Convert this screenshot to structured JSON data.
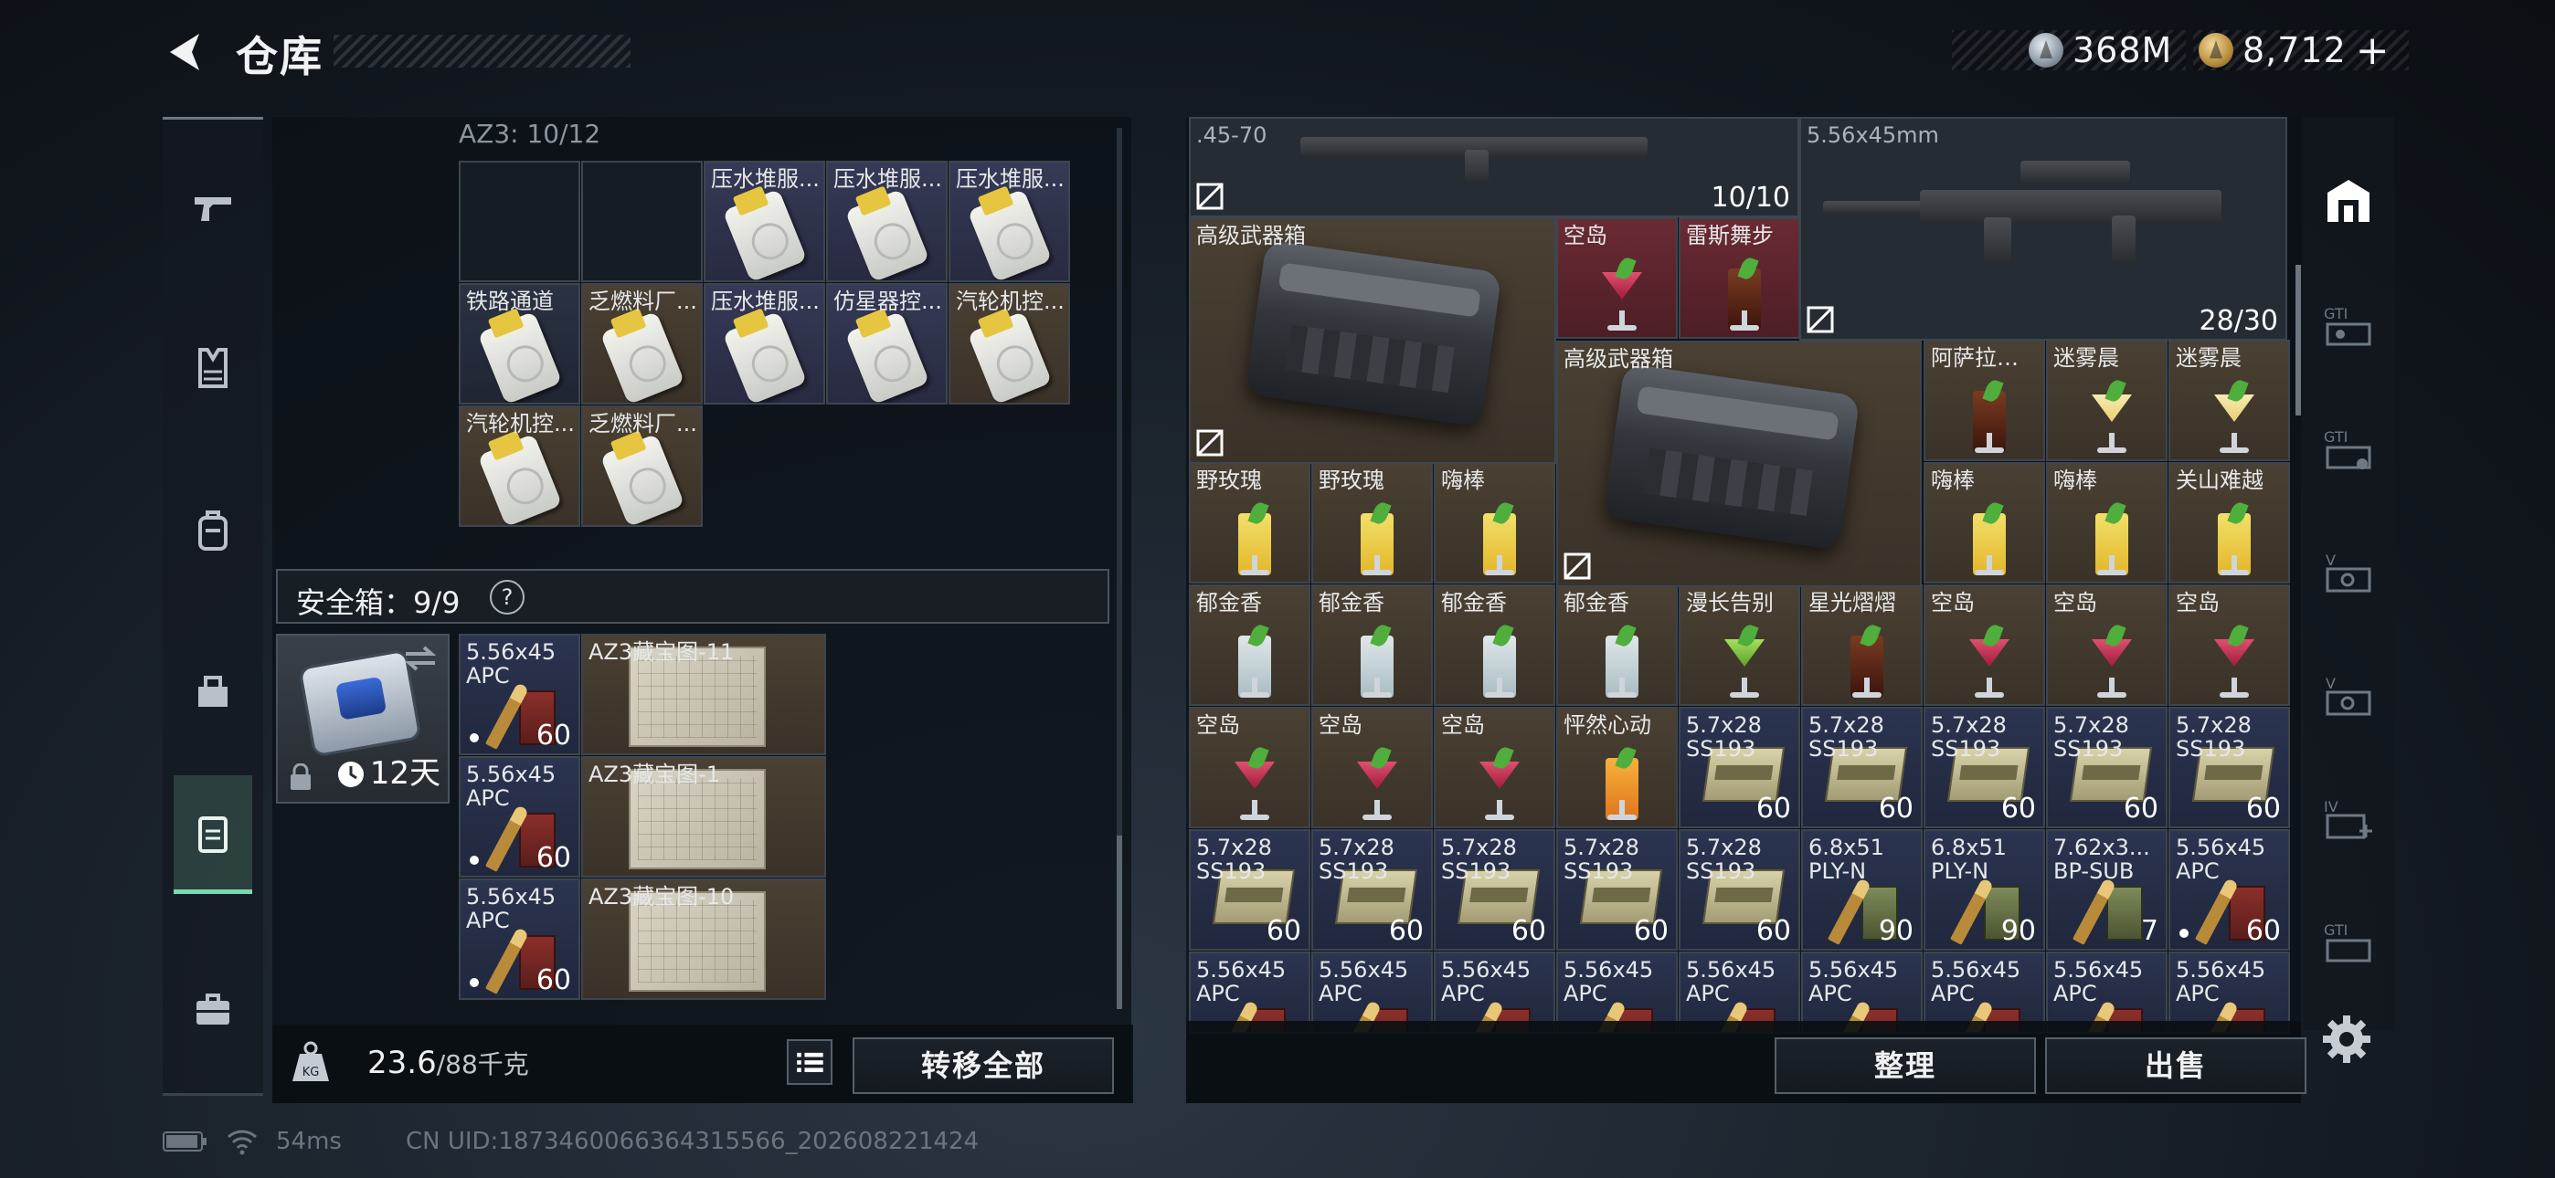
{
  "header": {
    "title": "仓库",
    "silver": "368M",
    "gold": "8,712",
    "plus": "+"
  },
  "left": {
    "grid_label": "AZ3: 10/12",
    "keys": [
      {
        "name": "",
        "bg": "empty"
      },
      {
        "name": "",
        "bg": "empty"
      },
      {
        "name": "压水堆服...",
        "bg": "purple"
      },
      {
        "name": "压水堆服...",
        "bg": "purple"
      },
      {
        "name": "压水堆服...",
        "bg": "purple"
      },
      {
        "name": "铁路通道",
        "bg": "blue"
      },
      {
        "name": "乏燃料厂...",
        "bg": "brown"
      },
      {
        "name": "压水堆服...",
        "bg": "purple"
      },
      {
        "name": "仿星器控...",
        "bg": "purple"
      },
      {
        "name": "汽轮机控...",
        "bg": "brown"
      },
      {
        "name": "汽轮机控...",
        "bg": "brown"
      },
      {
        "name": "乏燃料厂...",
        "bg": "brown"
      }
    ],
    "safe": {
      "label": "安全箱：9/9",
      "help": "?",
      "days": "12天"
    },
    "safe_items": [
      {
        "ammo_l1": "5.56x45",
        "ammo_l2": "APC",
        "ammo_count": "60",
        "map": "AZ3藏宝图-11"
      },
      {
        "ammo_l1": "5.56x45",
        "ammo_l2": "APC",
        "ammo_count": "60",
        "map": "AZ3藏宝图-1"
      },
      {
        "ammo_l1": "5.56x45",
        "ammo_l2": "APC",
        "ammo_count": "60",
        "map": "AZ3藏宝图-10"
      }
    ],
    "weight": "23.6",
    "weight_max": "/88千克",
    "transfer_label": "转移全部"
  },
  "right": {
    "gun1": {
      "caliber": ".45-70",
      "count": "10/10"
    },
    "gun2": {
      "caliber": "5.56x45mm",
      "count": "28/30"
    },
    "weapon_box_1": "高级武器箱",
    "weapon_box_2": "高级武器箱",
    "cells": [
      {
        "r": 1,
        "c": 3,
        "name": "空岛",
        "bg": "red",
        "art": "drink",
        "kind": "d-martini d-red"
      },
      {
        "r": 1,
        "c": 4,
        "name": "雷斯舞步",
        "bg": "red",
        "art": "drink",
        "kind": "d-tall d-cola"
      },
      {
        "r": 2,
        "c": 6,
        "name": "阿萨拉风情",
        "bg": "brown",
        "art": "drink",
        "kind": "d-tall d-cola"
      },
      {
        "r": 2,
        "c": 7,
        "name": "迷雾晨",
        "bg": "brown",
        "art": "drink",
        "kind": "d-martini d-pale"
      },
      {
        "r": 2,
        "c": 8,
        "name": "迷雾晨",
        "bg": "brown",
        "art": "drink",
        "kind": "d-martini d-pale"
      },
      {
        "r": 3,
        "c": 0,
        "name": "野玫瑰",
        "bg": "brown",
        "art": "drink",
        "kind": "d-tall"
      },
      {
        "r": 3,
        "c": 1,
        "name": "野玫瑰",
        "bg": "brown",
        "art": "drink",
        "kind": "d-tall"
      },
      {
        "r": 3,
        "c": 2,
        "name": "嗨棒",
        "bg": "brown",
        "art": "drink",
        "kind": "d-tall"
      },
      {
        "r": 3,
        "c": 6,
        "name": "嗨棒",
        "bg": "brown",
        "art": "drink",
        "kind": "d-tall"
      },
      {
        "r": 3,
        "c": 7,
        "name": "嗨棒",
        "bg": "brown",
        "art": "drink",
        "kind": "d-tall"
      },
      {
        "r": 3,
        "c": 8,
        "name": "关山难越",
        "bg": "brown",
        "art": "drink",
        "kind": "d-tall"
      },
      {
        "r": 4,
        "c": 0,
        "name": "郁金香",
        "bg": "brown",
        "art": "drink",
        "kind": "d-tall d-clear"
      },
      {
        "r": 4,
        "c": 1,
        "name": "郁金香",
        "bg": "brown",
        "art": "drink",
        "kind": "d-tall d-clear"
      },
      {
        "r": 4,
        "c": 2,
        "name": "郁金香",
        "bg": "brown",
        "art": "drink",
        "kind": "d-tall d-clear"
      },
      {
        "r": 4,
        "c": 3,
        "name": "郁金香",
        "bg": "brown",
        "art": "drink",
        "kind": "d-tall d-clear"
      },
      {
        "r": 4,
        "c": 4,
        "name": "漫长告别",
        "bg": "brown",
        "art": "drink",
        "kind": "d-martini d-green"
      },
      {
        "r": 4,
        "c": 5,
        "name": "星光熠熠",
        "bg": "brown",
        "art": "drink",
        "kind": "d-tall d-cola"
      },
      {
        "r": 4,
        "c": 6,
        "name": "空岛",
        "bg": "brown",
        "art": "drink",
        "kind": "d-martini d-red"
      },
      {
        "r": 4,
        "c": 7,
        "name": "空岛",
        "bg": "brown",
        "art": "drink",
        "kind": "d-martini d-red"
      },
      {
        "r": 4,
        "c": 8,
        "name": "空岛",
        "bg": "brown",
        "art": "drink",
        "kind": "d-martini d-red"
      },
      {
        "r": 5,
        "c": 0,
        "name": "空岛",
        "bg": "brown",
        "art": "drink",
        "kind": "d-martini d-red"
      },
      {
        "r": 5,
        "c": 1,
        "name": "空岛",
        "bg": "brown",
        "art": "drink",
        "kind": "d-martini d-red"
      },
      {
        "r": 5,
        "c": 2,
        "name": "空岛",
        "bg": "brown",
        "art": "drink",
        "kind": "d-martini d-red"
      },
      {
        "r": 5,
        "c": 3,
        "name": "怦然心动",
        "bg": "brown",
        "art": "drink",
        "kind": "d-tall d-orange"
      },
      {
        "r": 5,
        "c": 4,
        "name": "5.7x28",
        "name2": "SS193",
        "bg": "navy",
        "art": "ammobox",
        "count": "60"
      },
      {
        "r": 5,
        "c": 5,
        "name": "5.7x28",
        "name2": "SS193",
        "bg": "navy",
        "art": "ammobox",
        "count": "60"
      },
      {
        "r": 5,
        "c": 6,
        "name": "5.7x28",
        "name2": "SS193",
        "bg": "navy",
        "art": "ammobox",
        "count": "60"
      },
      {
        "r": 5,
        "c": 7,
        "name": "5.7x28",
        "name2": "SS193",
        "bg": "navy",
        "art": "ammobox",
        "count": "60"
      },
      {
        "r": 5,
        "c": 8,
        "name": "5.7x28",
        "name2": "SS193",
        "bg": "navy",
        "art": "ammobox",
        "count": "60"
      },
      {
        "r": 6,
        "c": 0,
        "name": "5.7x28",
        "name2": "SS193",
        "bg": "navy",
        "art": "ammobox",
        "count": "60"
      },
      {
        "r": 6,
        "c": 1,
        "name": "5.7x28",
        "name2": "SS193",
        "bg": "navy",
        "art": "ammobox",
        "count": "60"
      },
      {
        "r": 6,
        "c": 2,
        "name": "5.7x28",
        "name2": "SS193",
        "bg": "navy",
        "art": "ammobox",
        "count": "60"
      },
      {
        "r": 6,
        "c": 3,
        "name": "5.7x28",
        "name2": "SS193",
        "bg": "navy",
        "art": "ammobox",
        "count": "60"
      },
      {
        "r": 6,
        "c": 4,
        "name": "5.7x28",
        "name2": "SS193",
        "bg": "navy",
        "art": "ammobox",
        "count": "60"
      },
      {
        "r": 6,
        "c": 5,
        "name": "6.8x51",
        "name2": "PLY-N",
        "bg": "navy",
        "art": "ammo",
        "kind": "ammogreen",
        "count": "90"
      },
      {
        "r": 6,
        "c": 6,
        "name": "6.8x51",
        "name2": "PLY-N",
        "bg": "navy",
        "art": "ammo",
        "kind": "ammogreen",
        "count": "90"
      },
      {
        "r": 6,
        "c": 7,
        "name": "7.62x3...",
        "name2": "BP-SUB",
        "bg": "navy",
        "art": "ammo",
        "kind": "ammogreen",
        "count": "7"
      },
      {
        "r": 6,
        "c": 8,
        "name": "5.56x45",
        "name2": "APC",
        "bg": "navy",
        "art": "ammo",
        "kind": "",
        "count": "60",
        "dot": true
      },
      {
        "r": 7,
        "c": 0,
        "name": "5.56x45",
        "name2": "APC",
        "bg": "navy",
        "art": "ammo",
        "kind": ""
      },
      {
        "r": 7,
        "c": 1,
        "name": "5.56x45",
        "name2": "APC",
        "bg": "navy",
        "art": "ammo",
        "kind": ""
      },
      {
        "r": 7,
        "c": 2,
        "name": "5.56x45",
        "name2": "APC",
        "bg": "navy",
        "art": "ammo",
        "kind": ""
      },
      {
        "r": 7,
        "c": 3,
        "name": "5.56x45",
        "name2": "APC",
        "bg": "navy",
        "art": "ammo",
        "kind": ""
      },
      {
        "r": 7,
        "c": 4,
        "name": "5.56x45",
        "name2": "APC",
        "bg": "navy",
        "art": "ammo",
        "kind": ""
      },
      {
        "r": 7,
        "c": 5,
        "name": "5.56x45",
        "name2": "APC",
        "bg": "navy",
        "art": "ammo",
        "kind": ""
      },
      {
        "r": 7,
        "c": 6,
        "name": "5.56x45",
        "name2": "APC",
        "bg": "navy",
        "art": "ammo",
        "kind": ""
      },
      {
        "r": 7,
        "c": 7,
        "name": "5.56x45",
        "name2": "APC",
        "bg": "navy",
        "art": "ammo",
        "kind": ""
      },
      {
        "r": 7,
        "c": 8,
        "name": "5.56x45",
        "name2": "APC",
        "bg": "navy",
        "art": "ammo",
        "kind": ""
      }
    ],
    "sort_label": "整理",
    "sell_label": "出售",
    "tabs": [
      "仓库主页",
      "GTI-1",
      "GTI-2",
      "V-1",
      "V-2",
      "IV",
      "GTI-3"
    ]
  },
  "status": {
    "ping": "54ms",
    "uid": "CN UID:1873460066364315566_202608221424"
  }
}
